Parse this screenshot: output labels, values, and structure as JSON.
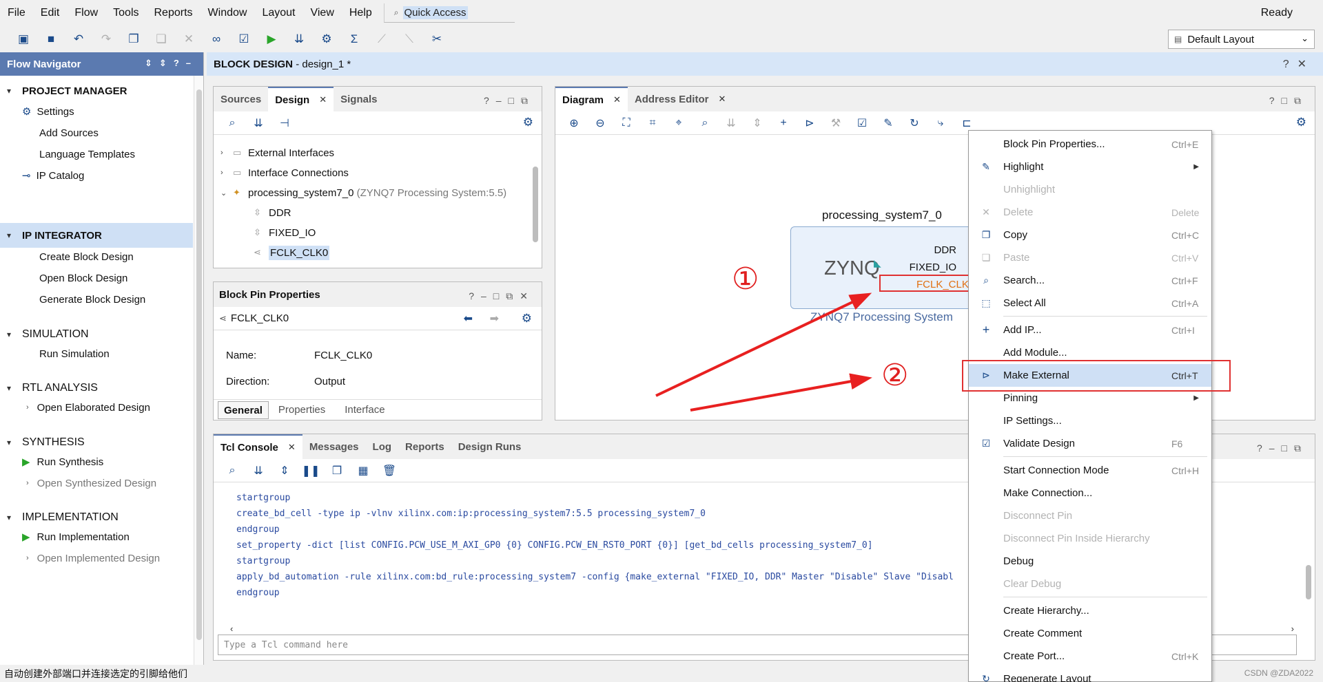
{
  "menubar": {
    "items": [
      "File",
      "Edit",
      "Flow",
      "Tools",
      "Reports",
      "Window",
      "Layout",
      "View",
      "Help"
    ],
    "quick_access": "Quick Access",
    "status": "Ready"
  },
  "toolbar": {
    "layout_select": "Default Layout"
  },
  "flow_navigator": {
    "title": "Flow Navigator",
    "project_manager": "PROJECT MANAGER",
    "pm_items": [
      "Settings",
      "Add Sources",
      "Language Templates",
      "IP Catalog"
    ],
    "ip_integrator": "IP INTEGRATOR",
    "ipi_items": [
      "Create Block Design",
      "Open Block Design",
      "Generate Block Design"
    ],
    "simulation": "SIMULATION",
    "sim_items": [
      "Run Simulation"
    ],
    "rtl_analysis": "RTL ANALYSIS",
    "rtl_items": [
      "Open Elaborated Design"
    ],
    "synthesis": "SYNTHESIS",
    "syn_items": [
      "Run Synthesis",
      "Open Synthesized Design"
    ],
    "implementation": "IMPLEMENTATION",
    "impl_items": [
      "Run Implementation",
      "Open Implemented Design"
    ]
  },
  "block_design": {
    "title": "BLOCK DESIGN",
    "subtitle": "- design_1 *"
  },
  "sources_panel": {
    "tabs": [
      "Sources",
      "Design",
      "Signals"
    ],
    "tree": {
      "external_interfaces": "External Interfaces",
      "interface_connections": "Interface Connections",
      "ps7": "processing_system7_0",
      "ps7_desc": "(ZYNQ7 Processing System:5.5)",
      "ddr": "DDR",
      "fixed_io": "FIXED_IO",
      "fclk": "FCLK_CLK0"
    }
  },
  "pin_props": {
    "title": "Block Pin Properties",
    "pin": "FCLK_CLK0",
    "name_label": "Name:",
    "name_value": "FCLK_CLK0",
    "direction_label": "Direction:",
    "direction_value": "Output",
    "tabs": [
      "General",
      "Properties",
      "Interface"
    ]
  },
  "diagram": {
    "tabs": [
      "Diagram",
      "Address Editor"
    ],
    "block_title": "processing_system7_0",
    "logo": "ZYNQ",
    "block_sub": "ZYNQ7 Processing System",
    "pins": [
      "DDR",
      "FIXED_IO",
      "FCLK_CLK"
    ],
    "annot1": "①",
    "annot2": "②"
  },
  "console": {
    "tabs": [
      "Tcl Console",
      "Messages",
      "Log",
      "Reports",
      "Design Runs"
    ],
    "lines": [
      "startgroup",
      "create_bd_cell -type ip -vlnv xilinx.com:ip:processing_system7:5.5 processing_system7_0",
      "endgroup",
      "set_property -dict [list CONFIG.PCW_USE_M_AXI_GP0 {0} CONFIG.PCW_EN_RST0_PORT {0}] [get_bd_cells processing_system7_0]",
      "startgroup",
      "apply_bd_automation -rule xilinx.com:bd_rule:processing_system7 -config {make_external \"FIXED_IO, DDR\" Master \"Disable\" Slave \"Disabl",
      "endgroup"
    ],
    "input_placeholder": "Type a Tcl command here"
  },
  "status_bar": {
    "message": "自动创建外部端口并连接选定的引脚给他们",
    "watermark": "CSDN @ZDA2022"
  },
  "context_menu": {
    "items": [
      {
        "label": "Block Pin Properties...",
        "shortcut": "Ctrl+E"
      },
      {
        "label": "Highlight",
        "shortcut": ""
      },
      {
        "label": "Unhighlight",
        "shortcut": ""
      },
      {
        "label": "Delete",
        "shortcut": "Delete"
      },
      {
        "label": "Copy",
        "shortcut": "Ctrl+C"
      },
      {
        "label": "Paste",
        "shortcut": "Ctrl+V"
      },
      {
        "label": "Search...",
        "shortcut": "Ctrl+F"
      },
      {
        "label": "Select All",
        "shortcut": "Ctrl+A"
      },
      {
        "label": "Add IP...",
        "shortcut": "Ctrl+I"
      },
      {
        "label": "Add Module...",
        "shortcut": ""
      },
      {
        "label": "Make External",
        "shortcut": "Ctrl+T"
      },
      {
        "label": "Pinning",
        "shortcut": ""
      },
      {
        "label": "IP Settings...",
        "shortcut": ""
      },
      {
        "label": "Validate Design",
        "shortcut": "F6"
      },
      {
        "label": "Start Connection Mode",
        "shortcut": "Ctrl+H"
      },
      {
        "label": "Make Connection...",
        "shortcut": ""
      },
      {
        "label": "Disconnect Pin",
        "shortcut": ""
      },
      {
        "label": "Disconnect Pin Inside Hierarchy",
        "shortcut": ""
      },
      {
        "label": "Debug",
        "shortcut": ""
      },
      {
        "label": "Clear Debug",
        "shortcut": ""
      },
      {
        "label": "Create Hierarchy...",
        "shortcut": ""
      },
      {
        "label": "Create Comment",
        "shortcut": ""
      },
      {
        "label": "Create Port...",
        "shortcut": "Ctrl+K"
      },
      {
        "label": "Regenerate Layout",
        "shortcut": ""
      }
    ]
  },
  "colors": {
    "accent": "#5b7ab0",
    "selection": "#cfe0f5",
    "annotation": "#e02020"
  }
}
